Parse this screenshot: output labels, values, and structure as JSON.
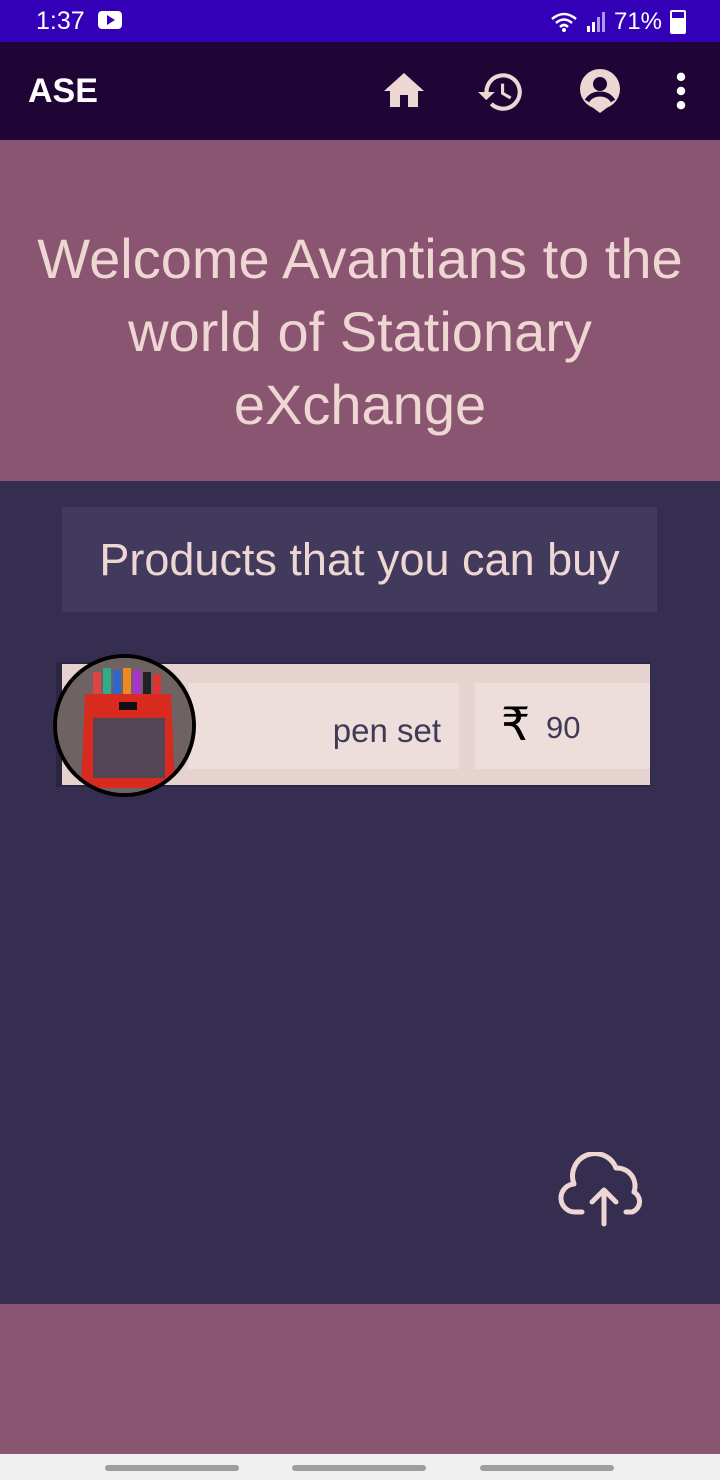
{
  "status_bar": {
    "time": "1:37",
    "battery": "71%"
  },
  "app_bar": {
    "title": "ASE",
    "icons": [
      "home-icon",
      "history-icon",
      "account-icon",
      "more-vert-icon"
    ]
  },
  "banner": {
    "welcome_text": "Welcome Avantians to the world of Stationary eXchange"
  },
  "section": {
    "title": "Products that you can buy"
  },
  "products": [
    {
      "name": "pen set",
      "currency": "₹",
      "price": "90"
    }
  ],
  "fab": {
    "icon": "cloud-upload-icon"
  },
  "colors": {
    "status_bar": "#3400b8",
    "app_bar": "#1e0536",
    "banner": "#8a5570",
    "background": "#352e50",
    "accent_text": "#eed6d3"
  }
}
